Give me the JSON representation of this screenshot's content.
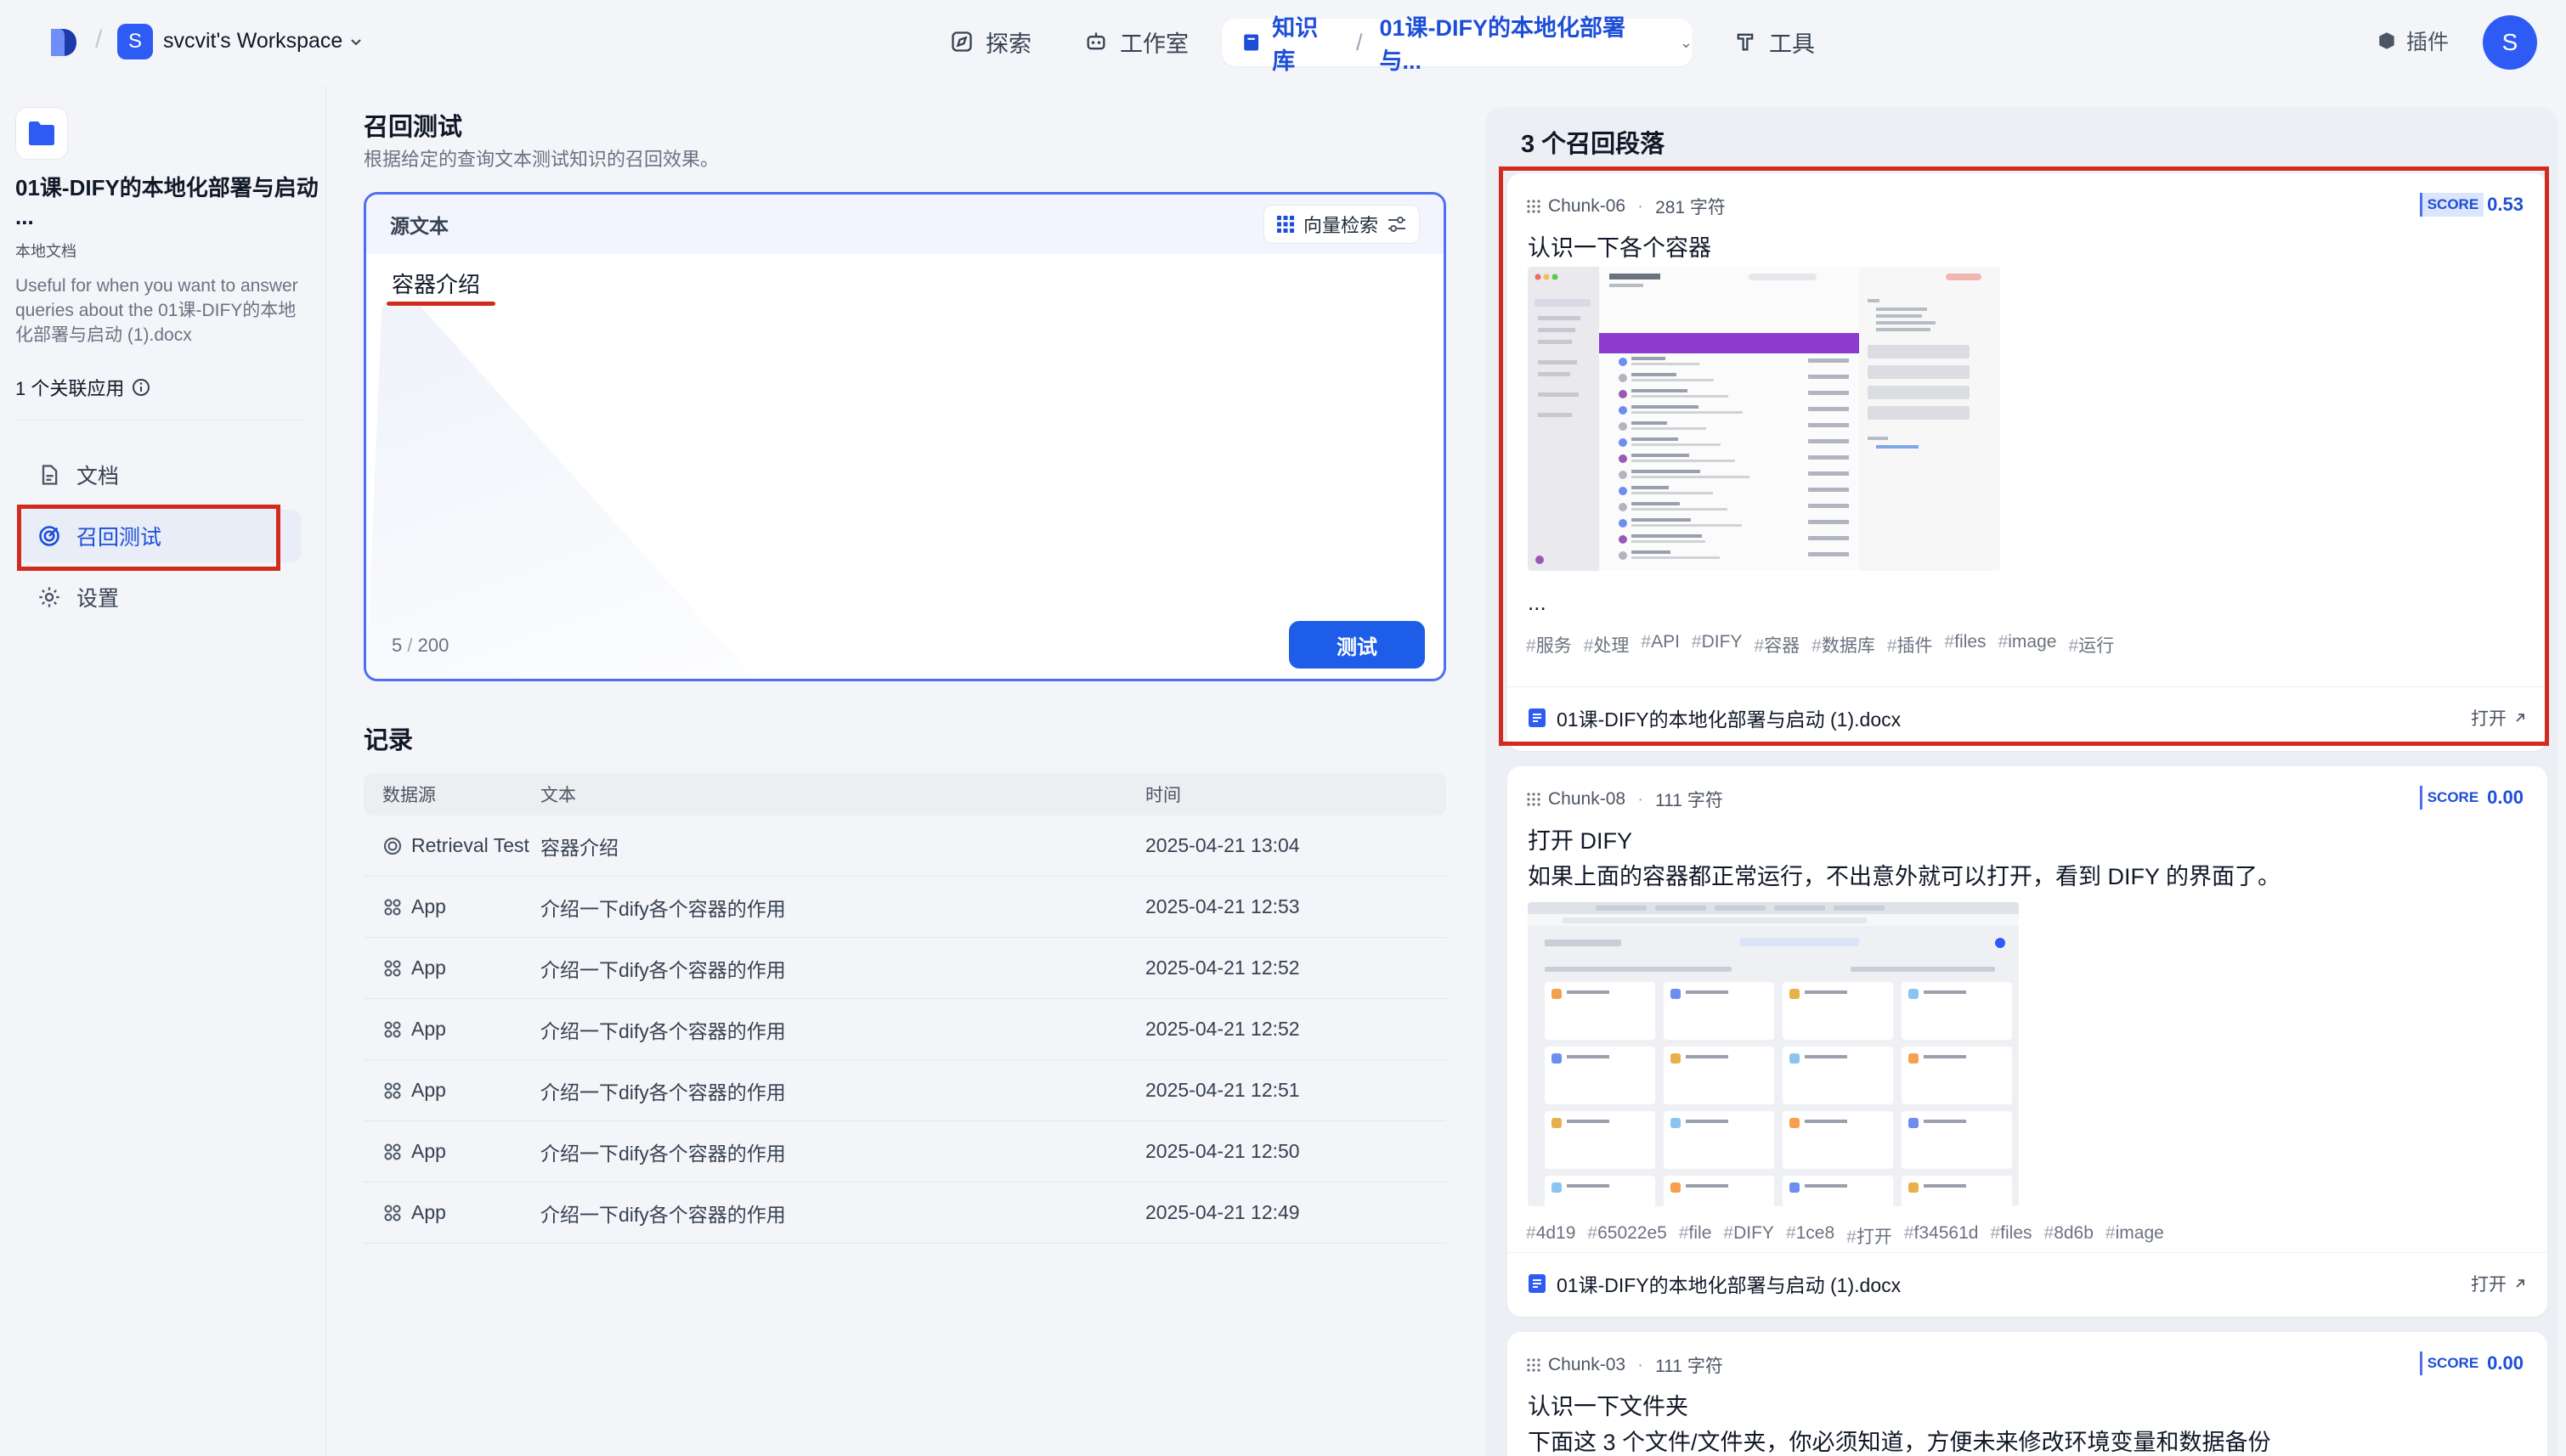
{
  "topnav": {
    "workspace_initial": "S",
    "workspace_name": "svcvit's Workspace",
    "explore": "探索",
    "studio": "工作室",
    "knowledge": "知识库",
    "kb_current": "01课-DIFY的本地化部署与...",
    "tools": "工具",
    "plugins": "插件",
    "user_initial": "S"
  },
  "sidebar": {
    "kb_title": "01课-DIFY的本地化部署与启动 ...",
    "kb_type": "本地文档",
    "kb_description": "Useful for when you want to answer queries about the 01课-DIFY的本地化部署与启动 (1).docx",
    "linked_apps": "1 个关联应用",
    "items": [
      {
        "label": "文档",
        "icon": "document-icon",
        "active": false
      },
      {
        "label": "召回测试",
        "icon": "target-icon",
        "active": true
      },
      {
        "label": "设置",
        "icon": "gear-icon",
        "active": false
      }
    ]
  },
  "test": {
    "title": "召回测试",
    "subtitle": "根据给定的查询文本测试知识的召回效果。",
    "source_label": "源文本",
    "retrieval_mode": "向量检索",
    "query": "容器介绍",
    "count": "5",
    "max": "200",
    "button": "测试"
  },
  "records": {
    "title": "记录",
    "headers": [
      "数据源",
      "文本",
      "时间"
    ],
    "rows": [
      {
        "source": "Retrieval Test",
        "text": "容器介绍",
        "time": "2025-04-21 13:04",
        "icon": "target-icon"
      },
      {
        "source": "App",
        "text": "介绍一下dify各个容器的作用",
        "time": "2025-04-21 12:53",
        "icon": "app-grid-icon"
      },
      {
        "source": "App",
        "text": "介绍一下dify各个容器的作用",
        "time": "2025-04-21 12:52",
        "icon": "app-grid-icon"
      },
      {
        "source": "App",
        "text": "介绍一下dify各个容器的作用",
        "time": "2025-04-21 12:52",
        "icon": "app-grid-icon"
      },
      {
        "source": "App",
        "text": "介绍一下dify各个容器的作用",
        "time": "2025-04-21 12:51",
        "icon": "app-grid-icon"
      },
      {
        "source": "App",
        "text": "介绍一下dify各个容器的作用",
        "time": "2025-04-21 12:50",
        "icon": "app-grid-icon"
      },
      {
        "source": "App",
        "text": "介绍一下dify各个容器的作用",
        "time": "2025-04-21 12:49",
        "icon": "app-grid-icon"
      }
    ]
  },
  "results": {
    "title": "3 个召回段落",
    "chunks": [
      {
        "id": "Chunk-06",
        "chars": "281 字符",
        "score_label": "SCORE",
        "score": "0.53",
        "title": "认识一下各个容器",
        "body": "",
        "ellipsis": "...",
        "tags": [
          "服务",
          "处理",
          "API",
          "DIFY",
          "容器",
          "数据库",
          "插件",
          "files",
          "image",
          "运行"
        ],
        "doc": "01课-DIFY的本地化部署与启动 (1).docx",
        "open": "打开"
      },
      {
        "id": "Chunk-08",
        "chars": "111 字符",
        "score_label": "SCORE",
        "score": "0.00",
        "title": "打开 DIFY",
        "body": "如果上面的容器都正常运行，不出意外就可以打开，看到 DIFY 的界面了。",
        "tags": [
          "4d19",
          "65022e5",
          "file",
          "DIFY",
          "1ce8",
          "打开",
          "f34561d",
          "files",
          "8d6b",
          "image"
        ],
        "doc": "01课-DIFY的本地化部署与启动 (1).docx",
        "open": "打开"
      },
      {
        "id": "Chunk-03",
        "chars": "111 字符",
        "score_label": "SCORE",
        "score": "0.00",
        "title": "认识一下文件夹",
        "body": "下面这 3 个文件/文件夹，你必须知道，方便未来修改环境变量和数据备份"
      }
    ]
  },
  "colors": {
    "accent": "#1e5de8",
    "highlight_box": "#d32a1e"
  }
}
